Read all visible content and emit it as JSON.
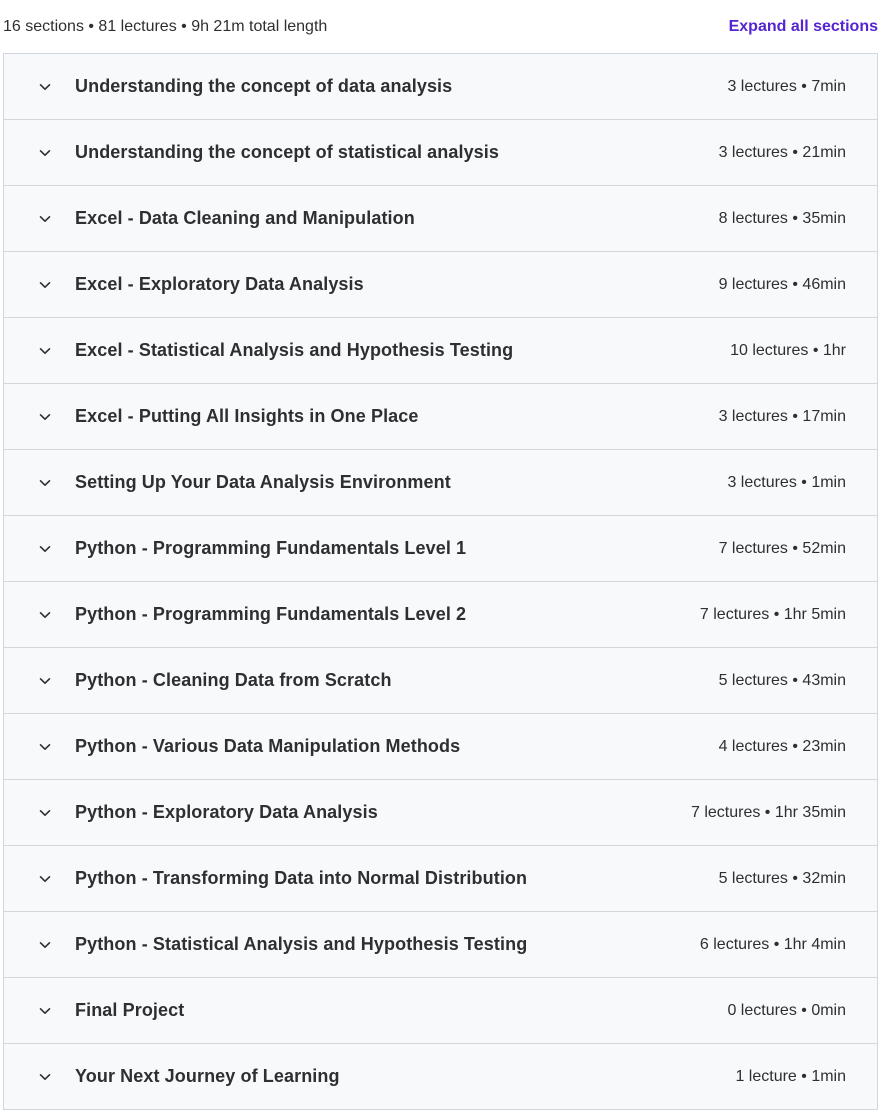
{
  "header": {
    "summary": "16 sections • 81 lectures • 9h 21m total length",
    "expand_all_label": "Expand all sections"
  },
  "icons": {
    "section_toggle": "chevron-down-icon"
  },
  "colors": {
    "link": "#5624d0",
    "row_background": "#f7f9fa",
    "border": "#d1d7dc",
    "text": "#2d2f31"
  },
  "sections": [
    {
      "title": "Understanding the concept of data analysis",
      "meta": "3 lectures • 7min"
    },
    {
      "title": "Understanding the concept of statistical analysis",
      "meta": "3 lectures • 21min"
    },
    {
      "title": "Excel - Data Cleaning and Manipulation",
      "meta": "8 lectures • 35min"
    },
    {
      "title": "Excel - Exploratory Data Analysis",
      "meta": "9 lectures • 46min"
    },
    {
      "title": "Excel - Statistical Analysis and Hypothesis Testing",
      "meta": "10 lectures • 1hr"
    },
    {
      "title": "Excel - Putting All Insights in One Place",
      "meta": "3 lectures • 17min"
    },
    {
      "title": "Setting Up Your Data Analysis Environment",
      "meta": "3 lectures • 1min"
    },
    {
      "title": "Python - Programming Fundamentals Level 1",
      "meta": "7 lectures • 52min"
    },
    {
      "title": "Python - Programming Fundamentals Level 2",
      "meta": "7 lectures • 1hr 5min"
    },
    {
      "title": "Python - Cleaning Data from Scratch",
      "meta": "5 lectures • 43min"
    },
    {
      "title": "Python - Various Data Manipulation Methods",
      "meta": "4 lectures • 23min"
    },
    {
      "title": "Python - Exploratory Data Analysis",
      "meta": "7 lectures • 1hr 35min"
    },
    {
      "title": "Python - Transforming Data into Normal Distribution",
      "meta": "5 lectures • 32min"
    },
    {
      "title": "Python - Statistical Analysis and Hypothesis Testing",
      "meta": "6 lectures • 1hr 4min"
    },
    {
      "title": "Final Project",
      "meta": "0 lectures • 0min"
    },
    {
      "title": "Your Next Journey of Learning",
      "meta": "1 lecture • 1min"
    }
  ]
}
